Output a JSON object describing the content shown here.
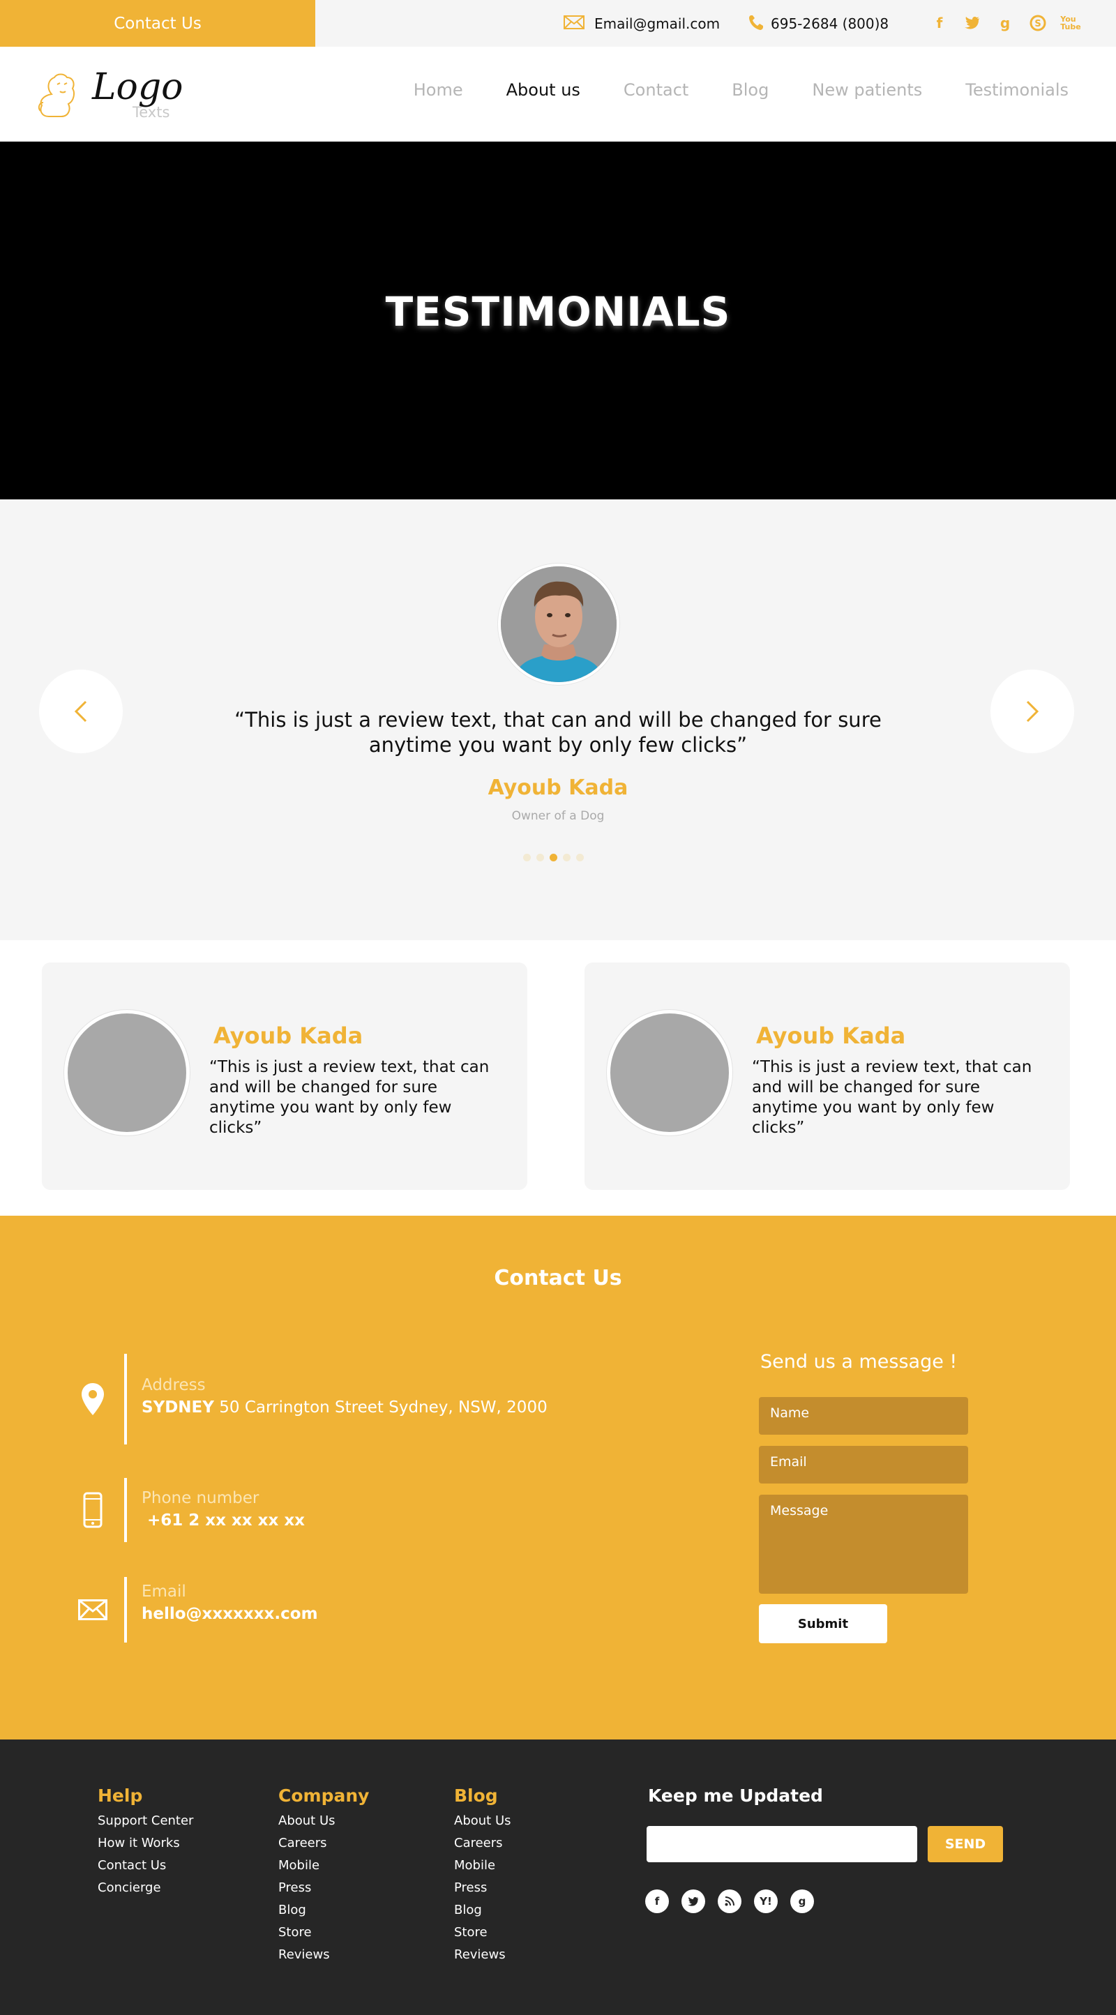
{
  "topbar": {
    "contact_label": "Contact Us",
    "email": "Email@gmail.com",
    "phone": "695-2684 (800)8",
    "social_icons": [
      "facebook-icon",
      "twitter-icon",
      "google-icon",
      "skype-icon",
      "youtube-icon"
    ]
  },
  "logo": {
    "title": "Logo",
    "subtitle": "Texts"
  },
  "nav": {
    "items": [
      {
        "label": "Home"
      },
      {
        "label": "About us"
      },
      {
        "label": "Contact"
      },
      {
        "label": "Blog"
      },
      {
        "label": "New patients"
      },
      {
        "label": "Testimonials"
      }
    ],
    "active_index": 1
  },
  "hero": {
    "title": "TESTIMONIALS"
  },
  "carousel": {
    "quote": "“This is just a review text, that can and will be changed for sure anytime you want by only few clicks”",
    "name": "Ayoub Kada",
    "role": "Owner of a Dog",
    "dots_count": 5,
    "active_dot": 2
  },
  "cards": [
    {
      "name": "Ayoub Kada",
      "text": "“This is just a review text, that can and will be changed for sure anytime you want by only few clicks”"
    },
    {
      "name": "Ayoub Kada",
      "text": "“This is just a review text, that can and will be changed for sure anytime you want by only few clicks”"
    }
  ],
  "contact": {
    "title": "Contact Us",
    "address_label": "Address",
    "address_city": "SYDNEY",
    "address_value": "50 Carrington Street Sydney, NSW, 2000",
    "phone_label": "Phone number",
    "phone_value": "+61 2 xx xx xx xx",
    "email_label": "Email",
    "email_value": "hello@xxxxxxx.com",
    "form_title": "Send us a message !",
    "name_placeholder": "Name",
    "email_placeholder": "Email",
    "message_placeholder": "Message",
    "submit_label": "Submit"
  },
  "footer": {
    "help": {
      "title": "Help",
      "links": [
        "Support Center",
        "How it Works",
        "Contact Us",
        "Concierge"
      ]
    },
    "company": {
      "title": "Company",
      "links": [
        "About Us",
        "Careers",
        "Mobile",
        "Press",
        "Blog",
        "Store",
        "Reviews"
      ]
    },
    "blog": {
      "title": "Blog",
      "links": [
        "About Us",
        "Careers",
        "Mobile",
        "Press",
        "Blog",
        "Store",
        "Reviews"
      ]
    },
    "keep_title": "Keep me Updated",
    "send_label": "SEND",
    "social_icons": [
      "facebook-icon",
      "twitter-icon",
      "rss-icon",
      "yahoo-icon",
      "google-icon"
    ]
  },
  "colors": {
    "accent": "#f0b336",
    "dark": "#262626",
    "light_bg": "#f5f5f5",
    "field": "#c48d2d"
  }
}
